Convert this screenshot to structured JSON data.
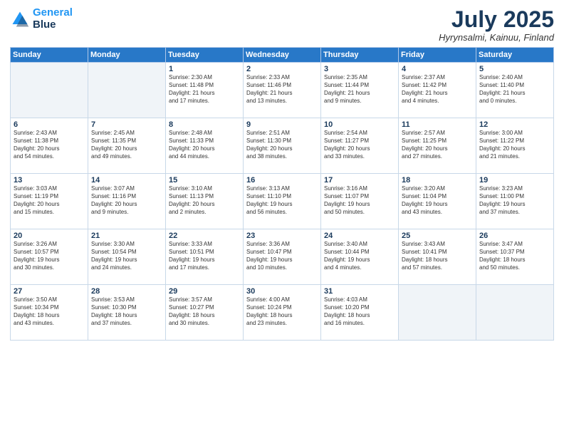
{
  "header": {
    "logo_line1": "General",
    "logo_line2": "Blue",
    "month": "July 2025",
    "location": "Hyrynsalmi, Kainuu, Finland"
  },
  "weekdays": [
    "Sunday",
    "Monday",
    "Tuesday",
    "Wednesday",
    "Thursday",
    "Friday",
    "Saturday"
  ],
  "weeks": [
    [
      {
        "day": "",
        "info": ""
      },
      {
        "day": "",
        "info": ""
      },
      {
        "day": "1",
        "info": "Sunrise: 2:30 AM\nSunset: 11:48 PM\nDaylight: 21 hours\nand 17 minutes."
      },
      {
        "day": "2",
        "info": "Sunrise: 2:33 AM\nSunset: 11:46 PM\nDaylight: 21 hours\nand 13 minutes."
      },
      {
        "day": "3",
        "info": "Sunrise: 2:35 AM\nSunset: 11:44 PM\nDaylight: 21 hours\nand 9 minutes."
      },
      {
        "day": "4",
        "info": "Sunrise: 2:37 AM\nSunset: 11:42 PM\nDaylight: 21 hours\nand 4 minutes."
      },
      {
        "day": "5",
        "info": "Sunrise: 2:40 AM\nSunset: 11:40 PM\nDaylight: 21 hours\nand 0 minutes."
      }
    ],
    [
      {
        "day": "6",
        "info": "Sunrise: 2:43 AM\nSunset: 11:38 PM\nDaylight: 20 hours\nand 54 minutes."
      },
      {
        "day": "7",
        "info": "Sunrise: 2:45 AM\nSunset: 11:35 PM\nDaylight: 20 hours\nand 49 minutes."
      },
      {
        "day": "8",
        "info": "Sunrise: 2:48 AM\nSunset: 11:33 PM\nDaylight: 20 hours\nand 44 minutes."
      },
      {
        "day": "9",
        "info": "Sunrise: 2:51 AM\nSunset: 11:30 PM\nDaylight: 20 hours\nand 38 minutes."
      },
      {
        "day": "10",
        "info": "Sunrise: 2:54 AM\nSunset: 11:27 PM\nDaylight: 20 hours\nand 33 minutes."
      },
      {
        "day": "11",
        "info": "Sunrise: 2:57 AM\nSunset: 11:25 PM\nDaylight: 20 hours\nand 27 minutes."
      },
      {
        "day": "12",
        "info": "Sunrise: 3:00 AM\nSunset: 11:22 PM\nDaylight: 20 hours\nand 21 minutes."
      }
    ],
    [
      {
        "day": "13",
        "info": "Sunrise: 3:03 AM\nSunset: 11:19 PM\nDaylight: 20 hours\nand 15 minutes."
      },
      {
        "day": "14",
        "info": "Sunrise: 3:07 AM\nSunset: 11:16 PM\nDaylight: 20 hours\nand 9 minutes."
      },
      {
        "day": "15",
        "info": "Sunrise: 3:10 AM\nSunset: 11:13 PM\nDaylight: 20 hours\nand 2 minutes."
      },
      {
        "day": "16",
        "info": "Sunrise: 3:13 AM\nSunset: 11:10 PM\nDaylight: 19 hours\nand 56 minutes."
      },
      {
        "day": "17",
        "info": "Sunrise: 3:16 AM\nSunset: 11:07 PM\nDaylight: 19 hours\nand 50 minutes."
      },
      {
        "day": "18",
        "info": "Sunrise: 3:20 AM\nSunset: 11:04 PM\nDaylight: 19 hours\nand 43 minutes."
      },
      {
        "day": "19",
        "info": "Sunrise: 3:23 AM\nSunset: 11:00 PM\nDaylight: 19 hours\nand 37 minutes."
      }
    ],
    [
      {
        "day": "20",
        "info": "Sunrise: 3:26 AM\nSunset: 10:57 PM\nDaylight: 19 hours\nand 30 minutes."
      },
      {
        "day": "21",
        "info": "Sunrise: 3:30 AM\nSunset: 10:54 PM\nDaylight: 19 hours\nand 24 minutes."
      },
      {
        "day": "22",
        "info": "Sunrise: 3:33 AM\nSunset: 10:51 PM\nDaylight: 19 hours\nand 17 minutes."
      },
      {
        "day": "23",
        "info": "Sunrise: 3:36 AM\nSunset: 10:47 PM\nDaylight: 19 hours\nand 10 minutes."
      },
      {
        "day": "24",
        "info": "Sunrise: 3:40 AM\nSunset: 10:44 PM\nDaylight: 19 hours\nand 4 minutes."
      },
      {
        "day": "25",
        "info": "Sunrise: 3:43 AM\nSunset: 10:41 PM\nDaylight: 18 hours\nand 57 minutes."
      },
      {
        "day": "26",
        "info": "Sunrise: 3:47 AM\nSunset: 10:37 PM\nDaylight: 18 hours\nand 50 minutes."
      }
    ],
    [
      {
        "day": "27",
        "info": "Sunrise: 3:50 AM\nSunset: 10:34 PM\nDaylight: 18 hours\nand 43 minutes."
      },
      {
        "day": "28",
        "info": "Sunrise: 3:53 AM\nSunset: 10:30 PM\nDaylight: 18 hours\nand 37 minutes."
      },
      {
        "day": "29",
        "info": "Sunrise: 3:57 AM\nSunset: 10:27 PM\nDaylight: 18 hours\nand 30 minutes."
      },
      {
        "day": "30",
        "info": "Sunrise: 4:00 AM\nSunset: 10:24 PM\nDaylight: 18 hours\nand 23 minutes."
      },
      {
        "day": "31",
        "info": "Sunrise: 4:03 AM\nSunset: 10:20 PM\nDaylight: 18 hours\nand 16 minutes."
      },
      {
        "day": "",
        "info": ""
      },
      {
        "day": "",
        "info": ""
      }
    ]
  ]
}
